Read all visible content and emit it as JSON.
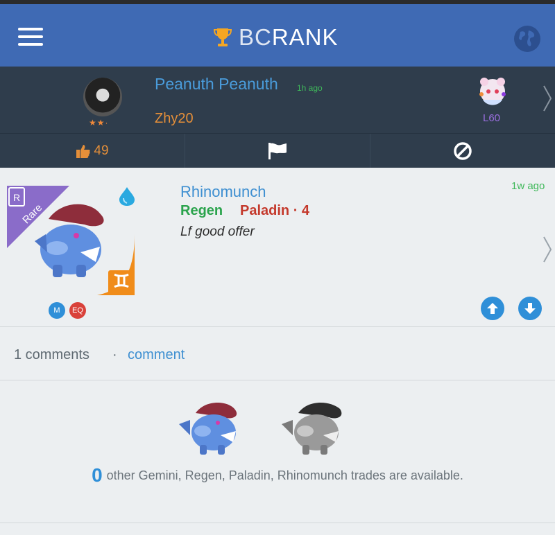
{
  "header": {
    "brand_bc": "BC",
    "brand_rank": "RANK",
    "menu_icon": "hamburger-menu-icon",
    "trophy_icon": "trophy-icon",
    "globe_icon": "globe-icon",
    "color": "#3f6ab4"
  },
  "post_author": {
    "name": "Peanuth Peanuth",
    "time": "1h ago",
    "stars": "★★·",
    "subtitle": "Zhy20",
    "monster_level": "L60"
  },
  "actions": {
    "like_count": "49",
    "like_icon": "thumbs-up-icon",
    "flag_icon": "flag-icon",
    "block_icon": "block-icon"
  },
  "trade": {
    "rarity": "Rare",
    "rarity_letter": "R",
    "monster_name": "Rhinomunch",
    "trait": "Regen",
    "class": "Paladin · 4",
    "note": "Lf good offer",
    "time": "1w ago",
    "element_icon": "water-drop-icon",
    "zodiac_icon": "gemini-icon",
    "badges": [
      "M",
      "EQ"
    ],
    "upvote_icon": "arrow-up-icon",
    "downvote_icon": "arrow-down-icon"
  },
  "comments": {
    "count_label": "1 comments",
    "separator": "·",
    "link_label": "comment"
  },
  "related": {
    "count": "0",
    "text": "other Gemini, Regen, Paladin, Rhinomunch trades are available."
  },
  "colors": {
    "user_strip": "#2f3d4c",
    "link_blue": "#3e8fd1",
    "green": "#3fb85a",
    "orange": "#e58f39",
    "red": "#c4392c"
  }
}
